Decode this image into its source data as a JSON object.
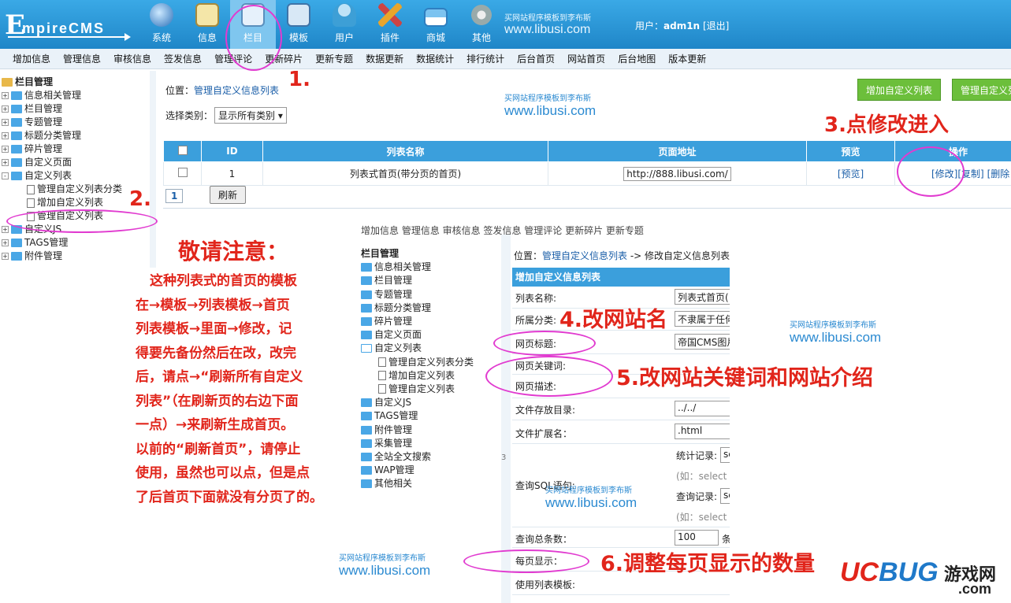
{
  "header": {
    "logo": {
      "first": "E",
      "rest": "mpireCMS"
    },
    "nav": [
      "系统",
      "信息",
      "栏目",
      "模板",
      "用户",
      "插件",
      "商城",
      "其他"
    ],
    "watermark_small": "买网站程序模板到李布斯",
    "watermark_url": "www.libusi.com",
    "user_label": "用户：",
    "username": "adm1n",
    "logout": "[退出]"
  },
  "subnav": [
    "增加信息",
    "管理信息",
    "审核信息",
    "签发信息",
    "管理评论",
    "更新碎片",
    "更新专题",
    "数据更新",
    "数据统计",
    "排行统计",
    "后台首页",
    "网站首页",
    "后台地图",
    "版本更新"
  ],
  "tree": {
    "root": "栏目管理",
    "items": [
      "信息相关管理",
      "栏目管理",
      "专题管理",
      "标题分类管理",
      "碎片管理",
      "自定义页面",
      "自定义列表"
    ],
    "children": [
      "管理自定义列表分类",
      "增加自定义列表",
      "管理自定义列表"
    ],
    "after": [
      "自定义JS",
      "TAGS管理",
      "附件管理"
    ]
  },
  "main": {
    "pos_label": "位置：",
    "pos_link": "管理自定义信息列表",
    "add_button": "增加自定义列表",
    "manage_button": "管理自定义列",
    "select_label": "选择类别：",
    "select_value": "显示所有类别",
    "columns": [
      "",
      "ID",
      "列表名称",
      "页面地址",
      "预览",
      "操作"
    ],
    "row": {
      "id": "1",
      "name": "列表式首页(带分页的首页)",
      "url": "http://888.libusi.com/",
      "preview": "[预览]",
      "edit": "[修改]",
      "copy": "[复制]",
      "del": "[删除"
    },
    "page": "1",
    "refresh": "刷新"
  },
  "annotations": {
    "step1": "1.",
    "step2": "2.",
    "step3": "3.点修改进入",
    "step4": "4.改网站名",
    "step5": "5.改网站关键词和网站介绍",
    "step6": "6.调整每页显示的数量",
    "notice_title": "敬请注意：",
    "notice_lines": [
      "这种列表式的首页的模板",
      "在→模板→列表模板→首页",
      "列表模板→里面→修改，记",
      "得要先备份然后在改，改完",
      "后，请点→“刷新所有自定义",
      "列表”（在刷新页的右边下面",
      "一点）→来刷新生成首页。",
      "以前的“刷新首页”，请停止",
      "使用，虽然也可以点，但是点",
      "了后首页下面就没有分页了的。"
    ],
    "accent_color": "#e1251b",
    "circle_color": "#e13bd0"
  },
  "inset": {
    "nav_strip": "增加信息  管理信息  审核信息  签发信息  管理评论  更新碎片  更新专题",
    "tree_root": "栏目管理",
    "tree_items": [
      "信息相关管理",
      "栏目管理",
      "专题管理",
      "标题分类管理",
      "碎片管理",
      "自定义页面",
      "自定义列表"
    ],
    "tree_children": [
      "管理自定义列表分类",
      "增加自定义列表",
      "管理自定义列表"
    ],
    "tree_after": [
      "自定义JS",
      "TAGS管理",
      "附件管理",
      "采集管理",
      "全站全文搜索",
      "WAP管理",
      "其他相关"
    ],
    "divider_text": "3",
    "pos_label": "位置：",
    "pos_link": "管理自定义信息列表",
    "pos_tail": " -> 修改自定义信息列表",
    "form_title": "增加自定义信息列表",
    "f_name_label": "列表名称:",
    "f_name_value": "列表式首页(",
    "f_class_label": "所属分类:",
    "f_class_value": "不隶属于任何",
    "f_title_label": "网页标题:",
    "f_title_value": "帝国CMS图片",
    "f_kw_label": "网页关键词:",
    "f_desc_label": "网页描述:",
    "f_dir_label": "文件存放目录:",
    "f_dir_value": "../../",
    "f_ext_label": "文件扩展名：",
    "f_ext_value": ".html",
    "f_sql_label": "查询SQL语句:",
    "f_sql_count_label": "统计记录:",
    "f_sql_count_value": "se",
    "f_sql_hint": "(如：select c",
    "f_sql_query_label": "查询记录:",
    "f_sql_query_value": "se",
    "f_sql_hint2": "(如：select *",
    "f_total_label": "查询总条数：",
    "f_total_value": "100",
    "f_total_unit": "条",
    "f_perpage_label": "每页显示：",
    "f_tpl_label": "使用列表模板:"
  },
  "brand": {
    "uc": "UC",
    "bug": "BUG",
    "game": "游戏网",
    "com": ".com"
  }
}
